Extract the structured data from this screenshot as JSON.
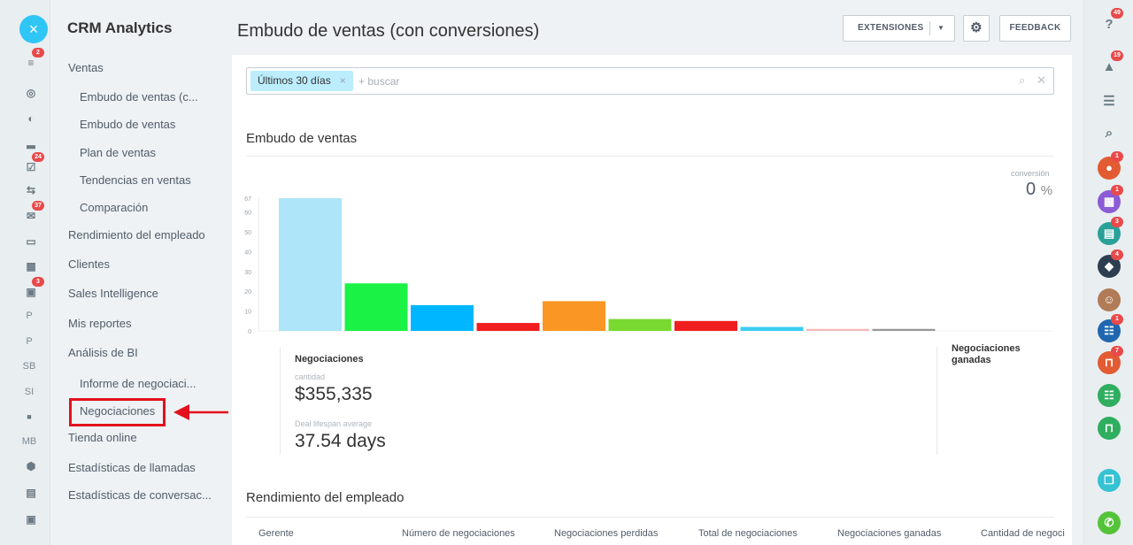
{
  "left_rail": {
    "items": [
      {
        "icon": "filter-icon",
        "glyph": "≡",
        "badge": "2"
      },
      {
        "icon": "activity-icon",
        "glyph": "◎",
        "badge": ""
      },
      {
        "icon": "clock-icon",
        "glyph": "◐",
        "badge": ""
      },
      {
        "icon": "chart-icon",
        "glyph": "▂",
        "badge": ""
      },
      {
        "icon": "tasks-icon",
        "glyph": "☑",
        "badge": "24"
      },
      {
        "icon": "sync-icon",
        "glyph": "⇆",
        "badge": ""
      },
      {
        "icon": "mail-icon",
        "glyph": "✉",
        "badge": "37"
      },
      {
        "icon": "window-icon",
        "glyph": "▭",
        "badge": ""
      },
      {
        "icon": "apps-icon",
        "glyph": "▦",
        "badge": ""
      },
      {
        "icon": "calendar-icon",
        "glyph": "▣",
        "badge": "3"
      }
    ],
    "text_items": [
      "P",
      "P",
      "SB",
      "SI",
      "",
      "MB"
    ]
  },
  "sidebar": {
    "title": "CRM Analytics",
    "items": [
      {
        "label": "Ventas",
        "level": 0
      },
      {
        "label": "Embudo de ventas (c...",
        "level": 1
      },
      {
        "label": "Embudo de ventas",
        "level": 1
      },
      {
        "label": "Plan de ventas",
        "level": 1
      },
      {
        "label": "Tendencias en ventas",
        "level": 1
      },
      {
        "label": "Comparación",
        "level": 1
      },
      {
        "label": "Rendimiento del empleado",
        "level": 0
      },
      {
        "label": "Clientes",
        "level": 0
      },
      {
        "label": "Sales Intelligence",
        "level": 0
      },
      {
        "label": "Mis reportes",
        "level": 0
      },
      {
        "label": "Análisis de BI",
        "level": 0
      },
      {
        "label": "Informe de negociaci...",
        "level": 1
      },
      {
        "label": "Negociaciones",
        "level": 1
      },
      {
        "label": "Tienda online",
        "level": 0
      },
      {
        "label": "Estadísticas de llamadas",
        "level": 0
      },
      {
        "label": "Estadísticas de conversac...",
        "level": 0
      }
    ]
  },
  "header": {
    "title": "Embudo de ventas (con conversiones)",
    "extensions_label": "EXTENSIONES",
    "feedback_label": "FEEDBACK"
  },
  "filter": {
    "chip_label": "Últimos 30 días",
    "placeholder": "+ buscar"
  },
  "funnel": {
    "section_title": "Embudo de ventas",
    "conversion_label": "conversión",
    "conversion_value": "0",
    "conversion_unit": "%"
  },
  "chart_data": {
    "type": "bar",
    "categories": [
      "",
      "",
      "",
      "",
      "",
      "",
      "",
      "",
      "",
      ""
    ],
    "values": [
      67,
      24,
      13,
      4,
      15,
      6,
      5,
      2,
      1,
      1
    ],
    "colors": [
      "#aee5f8",
      "#1bf246",
      "#00b7ff",
      "#f01e1e",
      "#fa9624",
      "#79d930",
      "#f01e1e",
      "#3ccdf0",
      "#f5b8b8",
      "#999999"
    ],
    "yticks": [
      0,
      10,
      20,
      30,
      40,
      50,
      60,
      67
    ],
    "ylim": [
      0,
      67
    ]
  },
  "stats": {
    "title": "Negociaciones",
    "amount_label": "cantidad",
    "amount_value": "$355,335",
    "lifespan_label": "Deal lifespan average",
    "lifespan_value": "37.54 days",
    "won_title": "Negociaciones ganadas"
  },
  "employee": {
    "section_title": "Rendimiento del empleado",
    "columns": [
      "Gerente",
      "Número de negociaciones",
      "Negociaciones perdidas",
      "Total de negociaciones",
      "Negociaciones ganadas",
      "Cantidad de negoci"
    ]
  },
  "right_rail": {
    "items": [
      {
        "icon": "help-icon",
        "glyph": "?",
        "badge": "49",
        "color": "#8a959c"
      },
      {
        "icon": "bell-icon",
        "glyph": "▲",
        "badge": "19",
        "color": "#8a959c"
      },
      {
        "icon": "chat-icon",
        "glyph": "☰",
        "badge": "",
        "color": "#8a959c"
      },
      {
        "icon": "search-icon",
        "glyph": "⌕",
        "badge": "",
        "color": "#8a959c"
      },
      {
        "icon": "user-avatar-icon",
        "glyph": "●",
        "badge": "1",
        "color": "#e25b32"
      },
      {
        "icon": "calendar-chat-icon",
        "glyph": "▦",
        "badge": "1",
        "color": "#8c5bd6"
      },
      {
        "icon": "group-chat-icon",
        "glyph": "▤",
        "badge": "3",
        "color": "#2aa198"
      },
      {
        "icon": "photo-avatar-icon",
        "glyph": "◆",
        "badge": "4",
        "color": "#2c3e50"
      },
      {
        "icon": "person-avatar-icon",
        "glyph": "☺",
        "badge": "",
        "color": "#b07b56"
      },
      {
        "icon": "team-chat-icon",
        "glyph": "☷",
        "badge": "1",
        "color": "#2067b0"
      },
      {
        "icon": "lock-chat-icon",
        "glyph": "⊓",
        "badge": "7",
        "color": "#e25b32"
      },
      {
        "icon": "users-chat-icon",
        "glyph": "☷",
        "badge": "",
        "color": "#2fae5f"
      },
      {
        "icon": "secure-chat-icon",
        "glyph": "⊓",
        "badge": "",
        "color": "#2fae5f"
      },
      {
        "icon": "copy-chat-icon",
        "glyph": "❐",
        "badge": "",
        "color": "#35c3d3"
      },
      {
        "icon": "phone-icon",
        "glyph": "✆",
        "badge": "",
        "color": "#55c33a"
      }
    ]
  }
}
